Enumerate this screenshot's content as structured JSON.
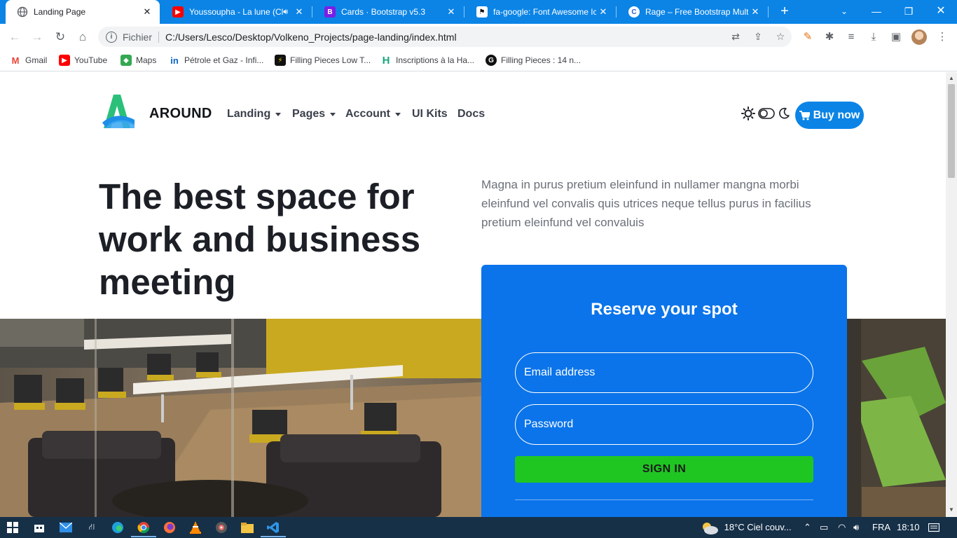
{
  "browser": {
    "tabs": [
      {
        "title": "Landing Page",
        "icon": "globe-icon",
        "active": true
      },
      {
        "title": "Youssoupha - La lune (Cl",
        "icon": "youtube-icon",
        "active": false
      },
      {
        "title": "Cards · Bootstrap v5.3",
        "icon": "bootstrap-icon",
        "active": false
      },
      {
        "title": "fa-google: Font Awesome Ico",
        "icon": "flag-icon",
        "active": false
      },
      {
        "title": "Rage – Free Bootstrap Multip",
        "icon": "rage-icon",
        "active": false
      }
    ],
    "address": {
      "scheme_label": "Fichier",
      "url": "C:/Users/Lesco/Desktop/Volkeno_Projects/page-landing/index.html"
    },
    "bookmarks": [
      {
        "label": "Gmail",
        "icon": "gmail-icon",
        "color": "#ea4335"
      },
      {
        "label": "YouTube",
        "icon": "youtube-icon",
        "color": "#ff0000"
      },
      {
        "label": "Maps",
        "icon": "maps-icon",
        "color": "#34a853"
      },
      {
        "label": "Pétrole et Gaz - Infi...",
        "icon": "linkedin-icon",
        "color": "#0a66c2"
      },
      {
        "label": "Filling Pieces Low T...",
        "icon": "bookmark-icon",
        "color": "#d6c000"
      },
      {
        "label": "Inscriptions à la Ha...",
        "icon": "h-icon",
        "color": "#17a77e"
      },
      {
        "label": "Filling Pieces : 14 n...",
        "icon": "github-icon",
        "color": "#111111"
      }
    ]
  },
  "page": {
    "brand": "AROUND",
    "nav": [
      {
        "label": "Landing",
        "dropdown": true
      },
      {
        "label": "Pages",
        "dropdown": true
      },
      {
        "label": "Account",
        "dropdown": true
      },
      {
        "label": "UI Kits",
        "dropdown": false
      },
      {
        "label": "Docs",
        "dropdown": false
      }
    ],
    "buy_button": "Buy now",
    "hero_title": "The best space for work and business meeting",
    "hero_text": "Magna in purus pretium eleinfund in nullamer mangna morbi eleinfund vel convalis quis utrices neque tellus purus in facilius pretium eleinfund vel convaluis",
    "form": {
      "title": "Reserve your spot",
      "email_placeholder": "Email address",
      "password_placeholder": "Password",
      "submit": "SIGN IN"
    },
    "colors": {
      "primary": "#0b74ea",
      "success": "#1fc622",
      "accent": "#0b84e6"
    }
  },
  "taskbar": {
    "weather": "18°C  Ciel couv...",
    "language": "FRA",
    "time": "18:10"
  }
}
